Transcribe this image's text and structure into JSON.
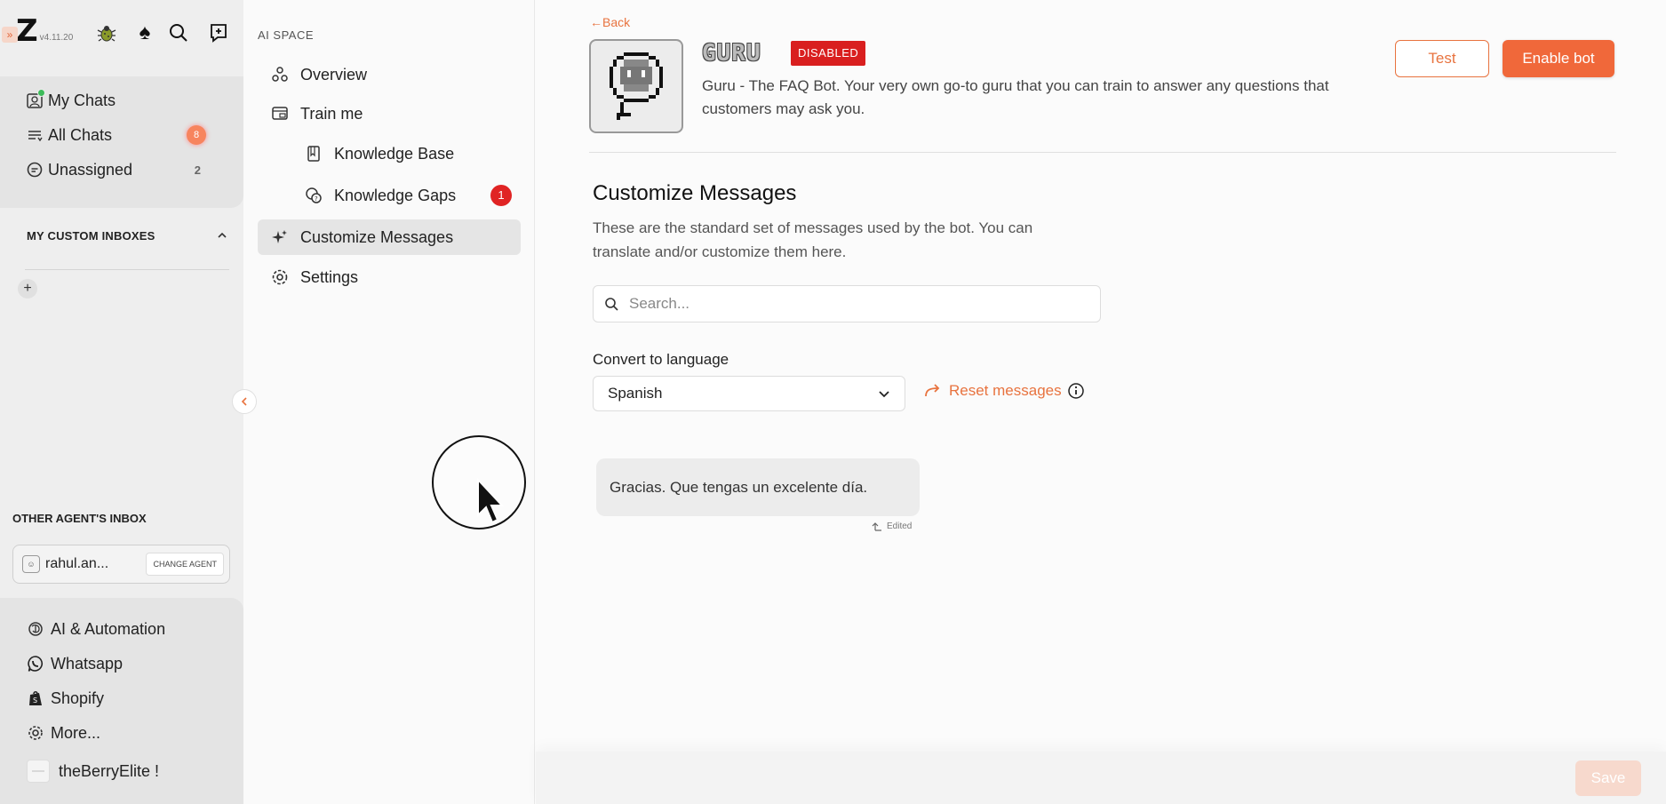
{
  "app": {
    "version": "v4.11.20",
    "logo_letter": "Z"
  },
  "sidebar": {
    "chats": [
      {
        "label": "My Chats",
        "icon": "my-chats-icon"
      },
      {
        "label": "All Chats",
        "icon": "list-icon",
        "badge": "8"
      },
      {
        "label": "Unassigned",
        "icon": "chat-bubble-icon",
        "count": "2"
      }
    ],
    "custom_inboxes_heading": "MY CUSTOM INBOXES",
    "other_agents_heading": "OTHER AGENT'S INBOX",
    "agent": {
      "name": "rahul.an...",
      "change_label": "CHANGE AGENT"
    },
    "bottom_nav": [
      {
        "label": "AI & Automation",
        "icon": "ai-automation-icon"
      },
      {
        "label": "Whatsapp",
        "icon": "whatsapp-icon"
      },
      {
        "label": "Shopify",
        "icon": "shopify-icon"
      },
      {
        "label": "More...",
        "icon": "gear-icon"
      }
    ],
    "store_name": "theBerryElite !"
  },
  "ai_menu": {
    "heading": "AI SPACE",
    "items": [
      {
        "label": "Overview"
      },
      {
        "label": "Train me"
      },
      {
        "label": "Knowledge Base"
      },
      {
        "label": "Knowledge Gaps",
        "badge": "1"
      },
      {
        "label": "Customize Messages"
      },
      {
        "label": "Settings"
      }
    ]
  },
  "main": {
    "back_label": "←Back",
    "bot_name": "GURU",
    "status": "DISABLED",
    "description": "Guru - The FAQ Bot. Your very own go-to guru that you can train to answer any questions that customers may ask you.",
    "test_label": "Test",
    "enable_label": "Enable bot",
    "section_title": "Customize Messages",
    "section_desc": "These are the standard set of messages used by the bot. You can translate and/or customize them here.",
    "search_placeholder": "Search...",
    "language_label": "Convert to language",
    "language_value": "Spanish",
    "reset_label": "Reset messages",
    "message_text": "Gracias. Que tengas un excelente día.",
    "edited_label": "Edited",
    "save_label": "Save"
  },
  "colors": {
    "accent": "#f0683a",
    "danger": "#d91f1f",
    "online": "#3dbb5a"
  }
}
